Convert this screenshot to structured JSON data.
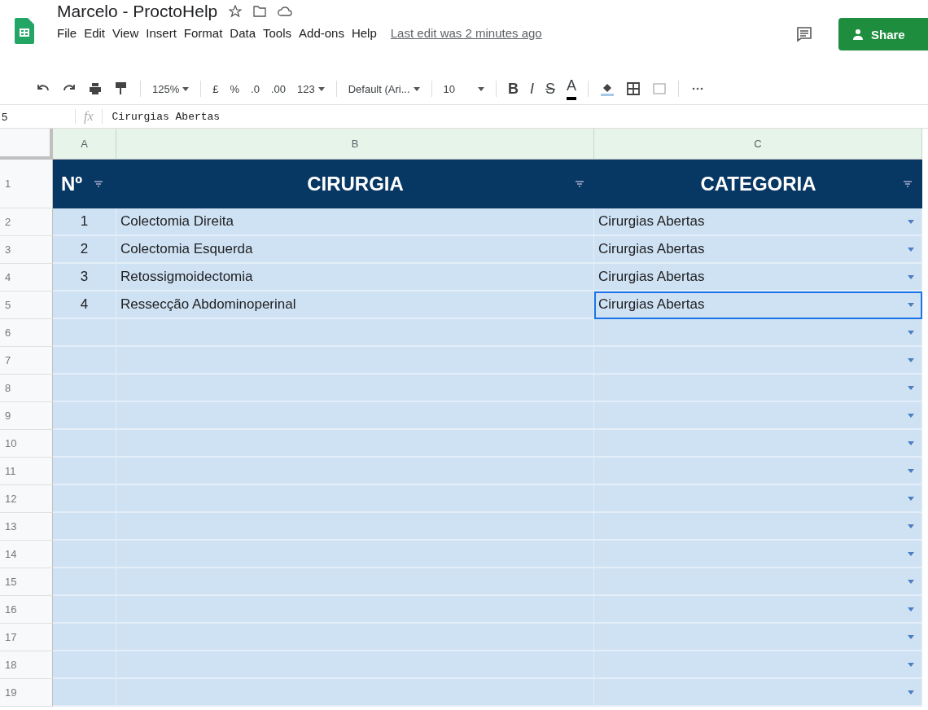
{
  "doc": {
    "title": "Marcelo - ProctoHelp",
    "last_edit": "Last edit was 2 minutes ago",
    "share": "Share"
  },
  "menu": [
    "File",
    "Edit",
    "View",
    "Insert",
    "Format",
    "Data",
    "Tools",
    "Add-ons",
    "Help"
  ],
  "toolbar": {
    "zoom": "125%",
    "currency": "£",
    "percent": "%",
    "dec_less": ".0",
    "dec_more": ".00",
    "format": "123",
    "font": "Default (Ari...",
    "size": "10",
    "bold": "B",
    "italic": "I",
    "strike": "S",
    "text_color": "A"
  },
  "formula_bar": {
    "cell_ref": "5",
    "fx": "fx",
    "value": "Cirurgias Abertas"
  },
  "columns": [
    "A",
    "B",
    "C"
  ],
  "header": {
    "row_number": "1",
    "cells": [
      "Nº",
      "CIRURGIA",
      "CATEGORIA"
    ]
  },
  "rows": [
    {
      "row_number": "2",
      "num": "1",
      "cirurgia": "Colectomia Direita",
      "categoria": "Cirurgias Abertas",
      "selected": false
    },
    {
      "row_number": "3",
      "num": "2",
      "cirurgia": "Colectomia Esquerda",
      "categoria": "Cirurgias Abertas",
      "selected": false
    },
    {
      "row_number": "4",
      "num": "3",
      "cirurgia": "Retossigmoidectomia",
      "categoria": "Cirurgias Abertas",
      "selected": false
    },
    {
      "row_number": "5",
      "num": "4",
      "cirurgia": "Ressecção Abdominoperinal",
      "categoria": "Cirurgias Abertas",
      "selected": true
    },
    {
      "row_number": "6",
      "selected": false
    },
    {
      "row_number": "7",
      "selected": false
    },
    {
      "row_number": "8",
      "selected": false
    },
    {
      "row_number": "9",
      "selected": false
    },
    {
      "row_number": "10",
      "selected": false
    },
    {
      "row_number": "11",
      "selected": false
    },
    {
      "row_number": "12",
      "selected": false
    },
    {
      "row_number": "13",
      "selected": false
    },
    {
      "row_number": "14",
      "selected": false
    },
    {
      "row_number": "15",
      "selected": false
    },
    {
      "row_number": "16",
      "selected": false
    },
    {
      "row_number": "17",
      "selected": false
    },
    {
      "row_number": "18",
      "selected": false
    },
    {
      "row_number": "19",
      "selected": false
    }
  ]
}
